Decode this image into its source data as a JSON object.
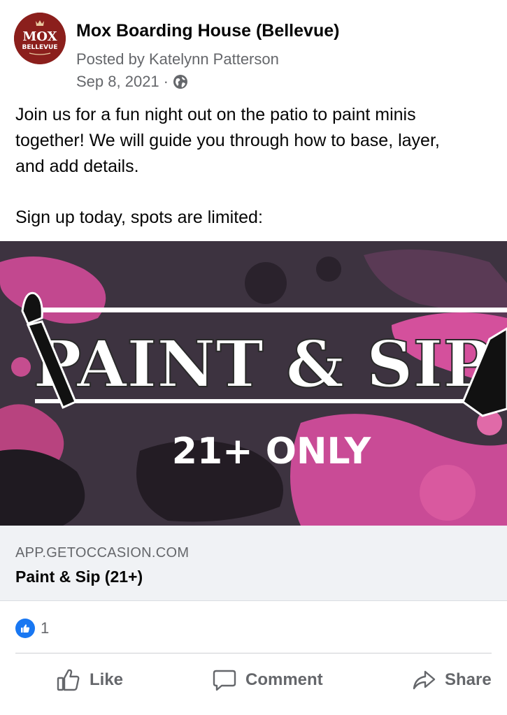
{
  "post": {
    "page_name": "Mox Boarding House (Bellevue)",
    "posted_by": "Posted by Katelynn Patterson",
    "date": "Sep 8, 2021",
    "separator": "·",
    "audience_icon": "globe-icon",
    "avatar": {
      "line1": "MOX",
      "line2": "BELLEVUE",
      "color": "#8b1f1c"
    },
    "body_lines": [
      "Join us for a fun night out on the patio to paint minis",
      "together! We will guide you through how to base, layer,",
      "and add details.",
      "Sign up today, spots are limited:"
    ]
  },
  "link_preview": {
    "image": {
      "title": "PAINT & SIP",
      "subtitle": "21+ ONLY"
    },
    "domain": "APP.GETOCCASION.COM",
    "title": "Paint & Sip (21+)"
  },
  "reactions": {
    "icon": "like-reaction-icon",
    "count": "1",
    "color": "#1877f2"
  },
  "actions": {
    "like": "Like",
    "comment": "Comment",
    "share": "Share"
  }
}
